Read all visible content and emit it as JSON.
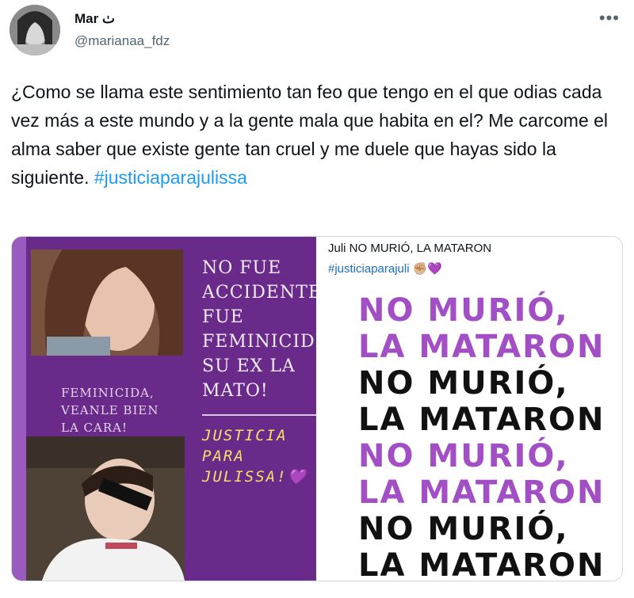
{
  "tweet": {
    "display_name": "Mar ٺ",
    "handle": "@marianaa_fdz",
    "more_icon": "more-dots-icon",
    "text": "¿Como se llama este sentimiento tan feo que tengo en el que odias cada vez más a este mundo y a la gente mala que habita en el? Me carcome el alma saber que existe gente tan cruel y me duele que hayas sido la siguiente.",
    "hashtag": "#justiciaparajulissa"
  },
  "media": {
    "left": {
      "caption": "FEMINICIDA, VEANLE BIEN LA CARA!",
      "big_text": [
        "NO FUE",
        "ACCIDENTE",
        "FUE",
        "FEMINICIDI",
        "SU EX LA",
        "MATO!"
      ],
      "justicia": [
        "JUSTICIA",
        "PARA",
        "JULISSA!💜"
      ]
    },
    "right": {
      "title": "Juli NO MURIÓ, LA MATARON",
      "tag": "#justiciaparajuli",
      "emoji": "✊🏼💜",
      "lines": [
        {
          "text": "NO MURIÓ,",
          "color": "#a24fc6"
        },
        {
          "text": "LA MATARON",
          "color": "#a24fc6"
        },
        {
          "text": "NO MURIÓ,",
          "color": "#111111"
        },
        {
          "text": "LA MATARON",
          "color": "#111111"
        },
        {
          "text": "NO MURIÓ,",
          "color": "#a24fc6"
        },
        {
          "text": "LA MATARON",
          "color": "#a24fc6"
        },
        {
          "text": "NO MURIÓ,",
          "color": "#111111"
        },
        {
          "text": "LA MATARON",
          "color": "#111111"
        }
      ]
    }
  }
}
